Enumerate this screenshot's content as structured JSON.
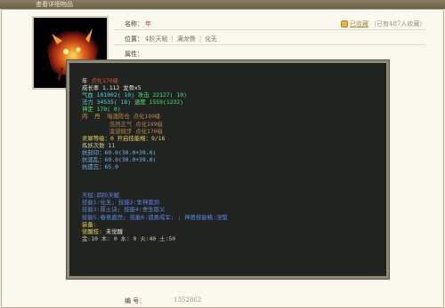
{
  "window": {
    "title": "查看详细物品"
  },
  "item": {
    "name_label": "名称：",
    "name_value": "年",
    "location_label": "位置：",
    "location": [
      "4阶天赋",
      "满龙骨",
      "化无"
    ],
    "attr_label": "属性："
  },
  "favorite": {
    "link": "已收藏",
    "count": "（已有487人收藏）"
  },
  "details": {
    "line1_a": "年",
    "line1_b": "点化170级",
    "growth": "成长率 1.112 龙骨x5",
    "hp": "气血 101902( 10)",
    "atk": "攻击 22127( 10)",
    "mp": "法力 34535( 18)",
    "spd": "速度 1559(1232)",
    "dodge": "神定 170( 0)",
    "inner_title": "内  丹",
    "inner1": "暗渡陈仓 点化199级",
    "inner2": "浩然正气 点化199级",
    "inner3": "凌波微步 点化170级",
    "spirit": "灵犀等级：0 开启技能格：9/16",
    "refine": "炼妖次数 11",
    "resist1": "抗封印：69.0(30.0+39.0)",
    "resist2": "抗混乱：69.0(30.0+39.0)",
    "resist3": "抗遗忘：65.0",
    "talent": "天赋:四阶天赋",
    "skill1": "技能1:化无; 技能2:鬼神莫测",
    "skill2": "技能3:厚土诀; 技能4:舍生取义",
    "skill3": "技能5:春意盎然; 技能6:孤勇成军; ; 神兽技能格:涅槃",
    "equip": "装备:",
    "awaken_a": "觉醒技:",
    "awaken_b": "未觉醒",
    "elements": "金:10 木: 0 水: 0 火:40 土:50"
  },
  "footer": {
    "label": "编    号：",
    "value": "1352862"
  }
}
